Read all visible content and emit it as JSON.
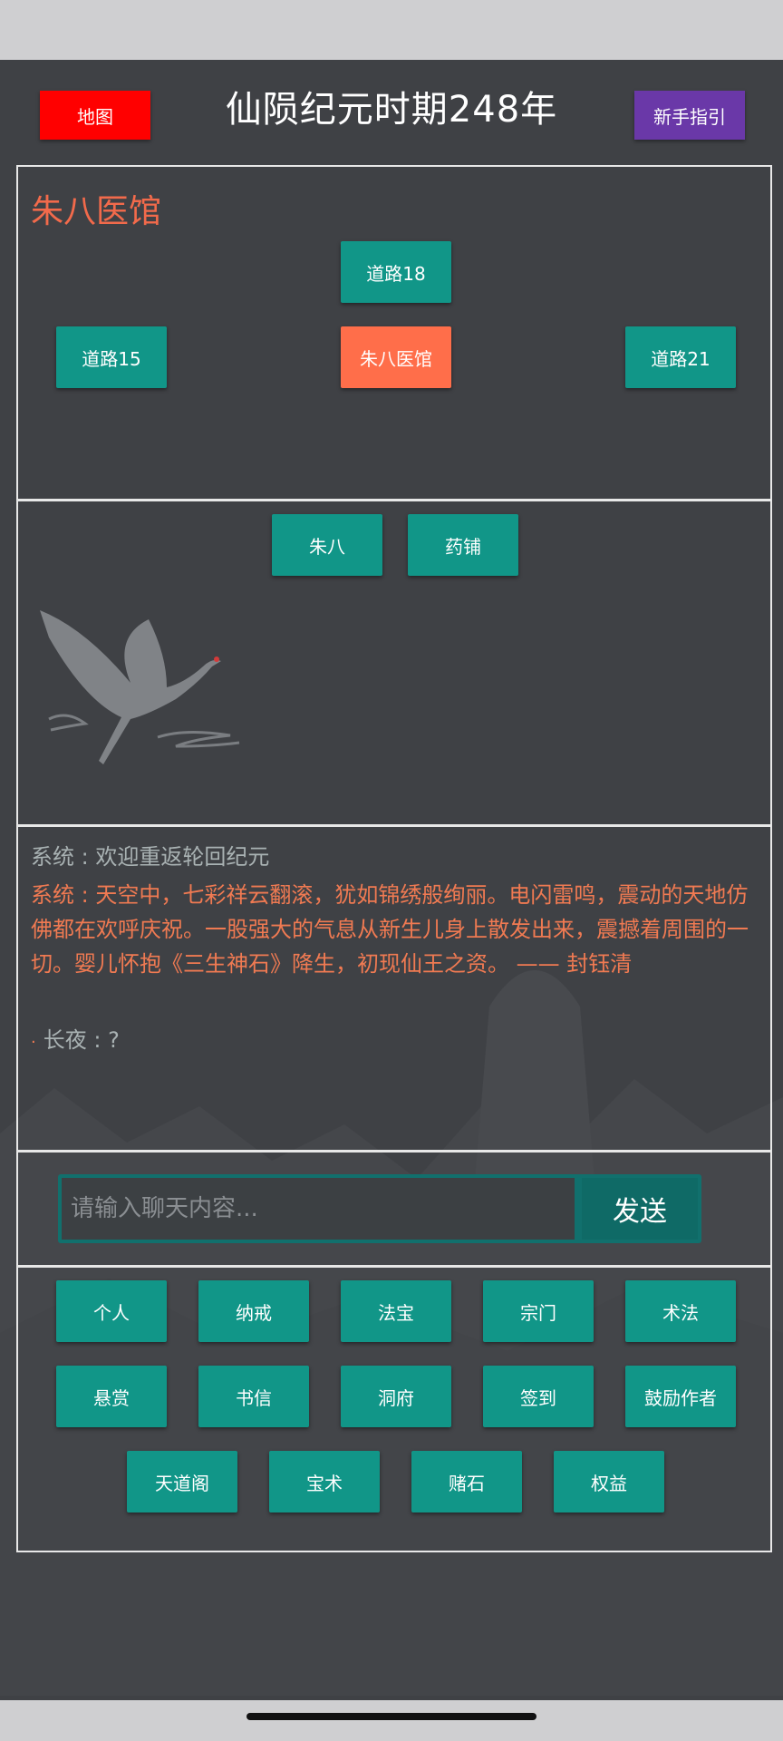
{
  "header": {
    "map_button": "地图",
    "title": "仙陨纪元时期248年",
    "guide_button": "新手指引"
  },
  "location": {
    "title": "朱八医馆",
    "north": "道路18",
    "west": "道路15",
    "current": "朱八医馆",
    "east": "道路21"
  },
  "npcs": [
    "朱八",
    "药铺"
  ],
  "log": {
    "line1": "系统 : 欢迎重返轮回纪元",
    "line2": "系统 : 天空中，七彩祥云翻滚，犹如锦绣般绚丽。电闪雷鸣，震动的天地仿佛都在欢呼庆祝。一股强大的气息从新生儿身上散发出来，震撼着周围的一切。婴儿怀抱《三生神石》降生，初现仙王之资。 —— 封钰清",
    "line3": "长夜 : ?"
  },
  "chat": {
    "placeholder": "请输入聊天内容...",
    "send": "发送"
  },
  "menu": {
    "row1": [
      "个人",
      "纳戒",
      "法宝",
      "宗门",
      "术法"
    ],
    "row2": [
      "悬赏",
      "书信",
      "洞府",
      "签到",
      "鼓励作者"
    ],
    "row3": [
      "天道阁",
      "宝术",
      "赌石",
      "权益"
    ]
  },
  "colors": {
    "background": "#3f4145",
    "teal_button": "#119688",
    "current_location": "#ff6e4a",
    "map_button": "#ff0000",
    "guide_button": "#6a38a8",
    "system_message": "#f07a52"
  },
  "icons": [
    "crane-illustration",
    "mountain-background"
  ]
}
